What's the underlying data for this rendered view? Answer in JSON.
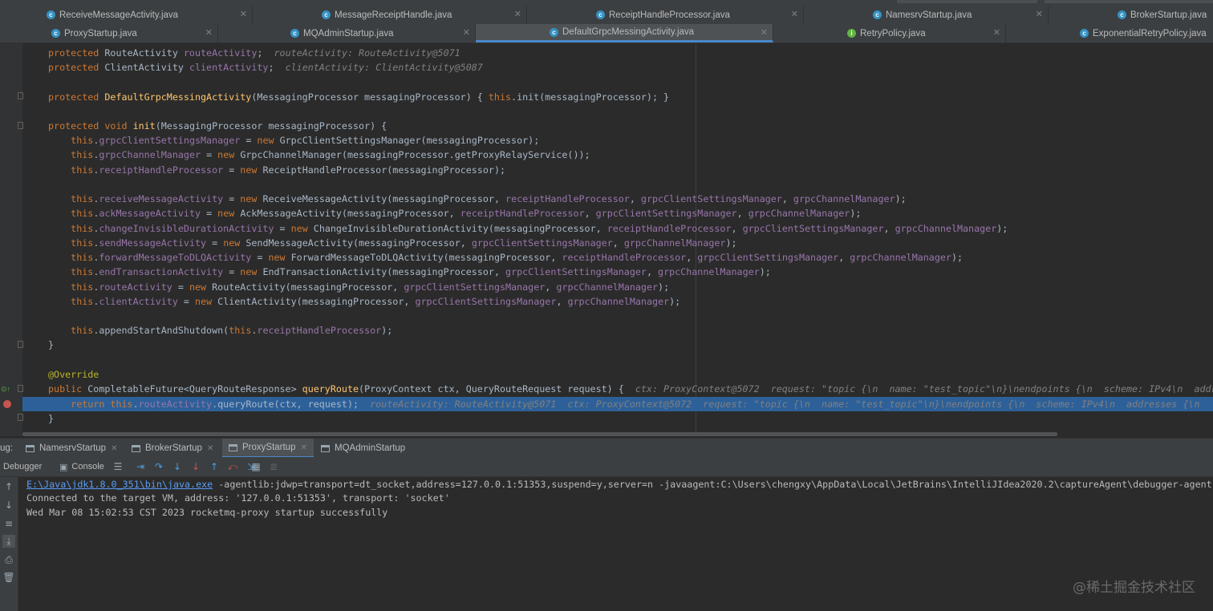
{
  "editor_tabs_row1": [
    {
      "label": "ReceiveMessageActivity.java",
      "icon": "class-icon",
      "closable": true
    },
    {
      "label": "MessageReceiptHandle.java",
      "icon": "class-icon",
      "closable": true
    },
    {
      "label": "ReceiptHandleProcessor.java",
      "icon": "class-icon",
      "closable": true
    },
    {
      "label": "NamesrvStartup.java",
      "icon": "class-icon",
      "closable": true
    },
    {
      "label": "BrokerStartup.java",
      "icon": "class-icon",
      "closable": false
    }
  ],
  "editor_tabs_row2": [
    {
      "label": "ProxyStartup.java",
      "icon": "class-icon",
      "closable": true
    },
    {
      "label": "MQAdminStartup.java",
      "icon": "class-icon",
      "closable": true
    },
    {
      "label": "DefaultGrpcMessingActivity.java",
      "icon": "class-icon",
      "closable": true,
      "active": true
    },
    {
      "label": "RetryPolicy.java",
      "icon": "interface-icon",
      "closable": true
    },
    {
      "label": "ExponentialRetryPolicy.java",
      "icon": "class-icon",
      "closable": false
    }
  ],
  "code": {
    "l1_hint": "routeActivity: RouteActivity@5071",
    "l2_hint": "clientActivity: ClientActivity@5087",
    "l25_hint": "ctx: ProxyContext@5072  request: \"topic {\\n  name: \"test_topic\"\\n}\\nendpoints {\\n  scheme: IPv4\\n  address",
    "l26_hint": "routeActivity: RouteActivity@5071  ctx: ProxyContext@5072  request: \"topic {\\n  name: \"test_topic\"\\n}\\nendpoints {\\n  scheme: IPv4\\n  addresses {\\n    h"
  },
  "debug": {
    "label": "ug:",
    "sessions": [
      {
        "label": "NamesrvStartup"
      },
      {
        "label": "BrokerStartup"
      },
      {
        "label": "ProxyStartup",
        "active": true
      },
      {
        "label": "MQAdminStartup"
      }
    ],
    "debugger_label": "Debugger",
    "console_label": "Console"
  },
  "console": {
    "line1_link": "E:\\Java\\jdk1.8.0_351\\bin\\java.exe",
    "line1_rest": " -agentlib:jdwp=transport=dt_socket,address=127.0.0.1:51353,suspend=y,server=n -javaagent:C:\\Users\\chengxy\\AppData\\Local\\JetBrains\\IntelliJIdea2020.2\\captureAgent\\debugger-agent.ja",
    "line2": "Connected to the target VM, address: '127.0.0.1:51353', transport: 'socket'",
    "line3": "Wed Mar 08 15:02:53 CST 2023 rocketmq-proxy startup successfully"
  },
  "watermark": "@稀土掘金技术社区",
  "colors": {
    "keyword": "#cc7832",
    "field": "#9876aa",
    "method": "#ffc66d",
    "string": "#6a8759",
    "annotation": "#bbb529",
    "hint": "#808080",
    "exec_line": "#2d6099"
  }
}
